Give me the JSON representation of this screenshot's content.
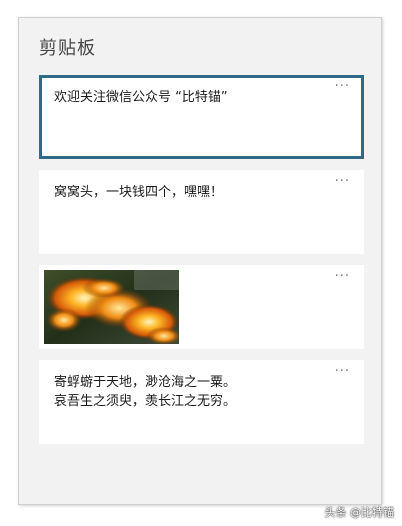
{
  "panel": {
    "title": "剪贴板"
  },
  "items": [
    {
      "type": "text",
      "text": "欢迎关注微信公众号 “比特锚”",
      "selected": true,
      "more_icon": "more-dots-icon"
    },
    {
      "type": "text",
      "text": "窝窝头，一块钱四个，嘿嘿！",
      "selected": false,
      "more_icon": "more-dots-icon"
    },
    {
      "type": "image",
      "image_desc": "fire-photo",
      "selected": false,
      "more_icon": "more-dots-icon"
    },
    {
      "type": "text",
      "text": "寄蜉蝣于天地，渺沧海之一粟。\n哀吾生之须臾，羡长江之无穷。",
      "selected": false,
      "more_icon": "more-dots-icon"
    }
  ],
  "more_glyph": "···",
  "colors": {
    "selected_border": "#2e6b86",
    "panel_bg": "#f2f2f2"
  },
  "watermark": "头条 @比特锚"
}
